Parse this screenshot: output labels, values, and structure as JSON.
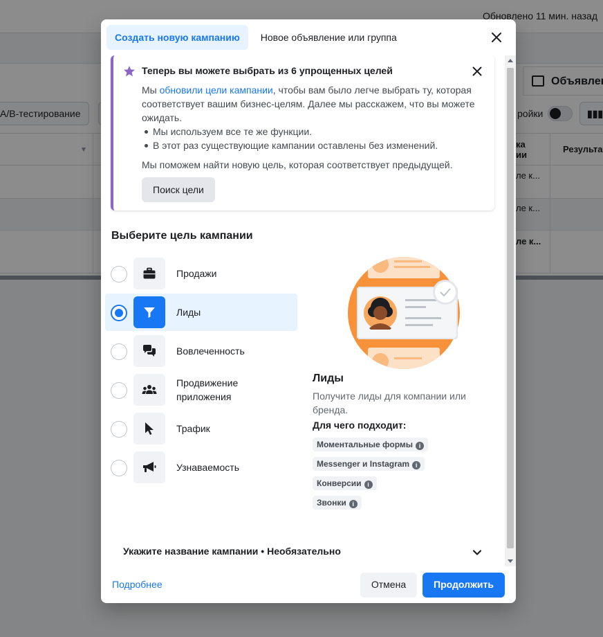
{
  "background": {
    "updated_text": "Обновлено 11 мин. назад",
    "ab_testing_label": "A/B-тестирование",
    "ads_tab_label": "Объявления",
    "settings_label": "ройки",
    "table": {
      "header_partial_1": "ка",
      "header_partial_2": "ии",
      "header_results": "Результаты",
      "row1_text": "ле к...",
      "row2_text": "ле к...",
      "row3_text": "ле к..."
    }
  },
  "modal": {
    "tabs": [
      {
        "label": "Создать новую кампанию",
        "active": true
      },
      {
        "label": "Новое объявление или группа",
        "active": false
      }
    ],
    "notice": {
      "title": "Теперь вы можете выбрать из 6 упрощенных целей",
      "body_prefix": "Мы ",
      "body_link": "обновили цели кампании",
      "body_suffix": ", чтобы вам было легче выбрать ту, которая соответствует вашим бизнес-целям. Далее мы расскажем, что вы можете ожидать.",
      "bullets": [
        "Мы используем все те же функции.",
        "В этот раз существующие кампании оставлены без изменений."
      ],
      "help_text": "Мы поможем найти новую цель, которая соответствует предыдущей.",
      "button_label": "Поиск цели"
    },
    "section_title": "Выберите цель кампании",
    "objectives": [
      {
        "label": "Продажи",
        "icon": "briefcase-icon",
        "selected": false
      },
      {
        "label": "Лиды",
        "icon": "filter-icon",
        "selected": true
      },
      {
        "label": "Вовлеченность",
        "icon": "chat-bubbles-icon",
        "selected": false
      },
      {
        "label": "Продвижение приложения",
        "icon": "people-icon",
        "selected": false
      },
      {
        "label": "Трафик",
        "icon": "cursor-icon",
        "selected": false
      },
      {
        "label": "Узнаваемость",
        "icon": "megaphone-icon",
        "selected": false
      }
    ],
    "detail": {
      "title": "Лиды",
      "description": "Получите лиды для компании или бренда.",
      "fit_label": "Для чего подходит:",
      "chips": [
        "Моментальные формы",
        "Messenger и Instagram",
        "Конверсии",
        "Звонки"
      ]
    },
    "campaign_name_label": "Укажите название кампании • Необязательно",
    "footer": {
      "learn_more": "Подробнее",
      "cancel": "Отмена",
      "continue": "Продолжить"
    }
  },
  "colors": {
    "accent": "#1877f2",
    "selected_bg": "#e7f3ff",
    "notice_border": "#8b66c7",
    "illustration_orange": "#f7923a"
  }
}
